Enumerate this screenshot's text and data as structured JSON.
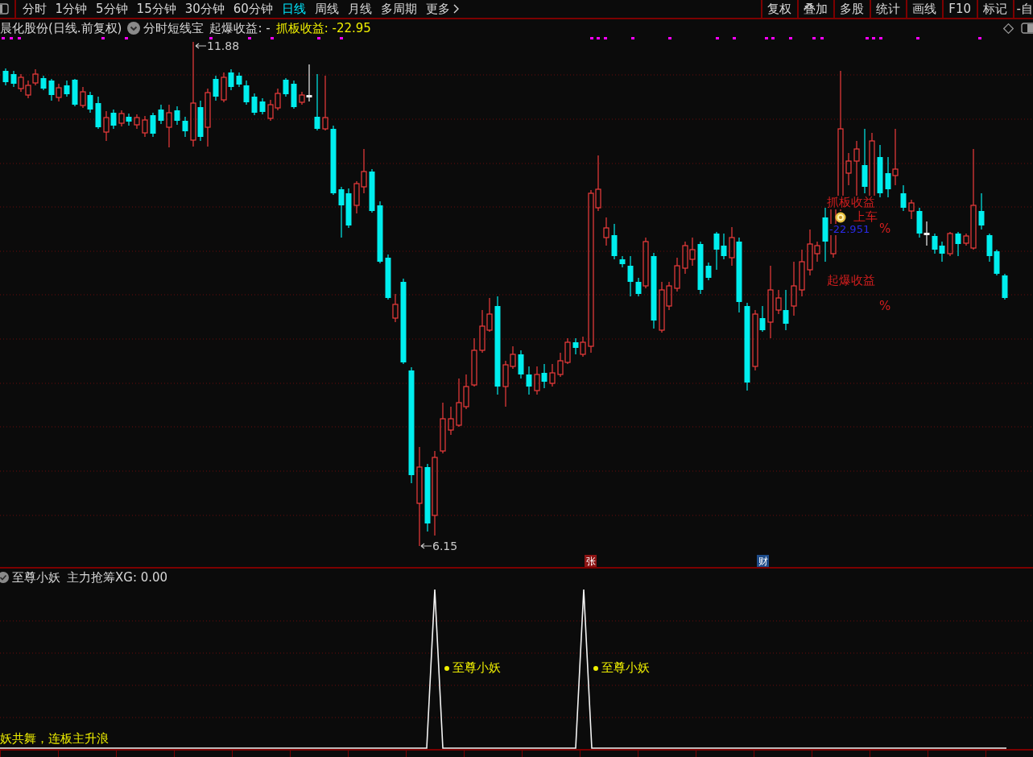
{
  "toolbar": {
    "periods": [
      {
        "label": "分时",
        "selected": false
      },
      {
        "label": "1分钟",
        "selected": false
      },
      {
        "label": "5分钟",
        "selected": false
      },
      {
        "label": "15分钟",
        "selected": false
      },
      {
        "label": "30分钟",
        "selected": false
      },
      {
        "label": "60分钟",
        "selected": false
      },
      {
        "label": "日线",
        "selected": true
      },
      {
        "label": "周线",
        "selected": false
      },
      {
        "label": "月线",
        "selected": false
      },
      {
        "label": "多周期",
        "selected": false
      }
    ],
    "more": "更多",
    "tools": [
      "复权",
      "叠加",
      "多股",
      "统计",
      "画线",
      "F10",
      "标记",
      "-自"
    ]
  },
  "chart_header": {
    "title": "晨化股份(日线.前复权)",
    "indicator": "分时短线宝",
    "readouts": [
      {
        "text": "起爆收益: -",
        "color": "#d8d8d8"
      },
      {
        "text": "抓板收益: -22.95",
        "color": "#f0f000"
      }
    ]
  },
  "price_chart": {
    "high_label": "11.88",
    "low_label": "6.15",
    "grab_return": {
      "label": "抓板收益",
      "unit": "%"
    },
    "entry_signal": {
      "label": "上车",
      "value": "-22.951"
    },
    "burst_return": {
      "label": "起爆收益",
      "unit": "%"
    },
    "event_badges": [
      {
        "text": "张",
        "color": "#8c1414"
      },
      {
        "text": "财",
        "color": "#1e4c8a"
      }
    ]
  },
  "signal_panel": {
    "title": "至尊小妖",
    "readout": "主力抢筹XG: 0.00",
    "signal_labels": [
      "至尊小妖",
      "至尊小妖"
    ],
    "slogan": "妖共舞，连板主升浪"
  }
}
